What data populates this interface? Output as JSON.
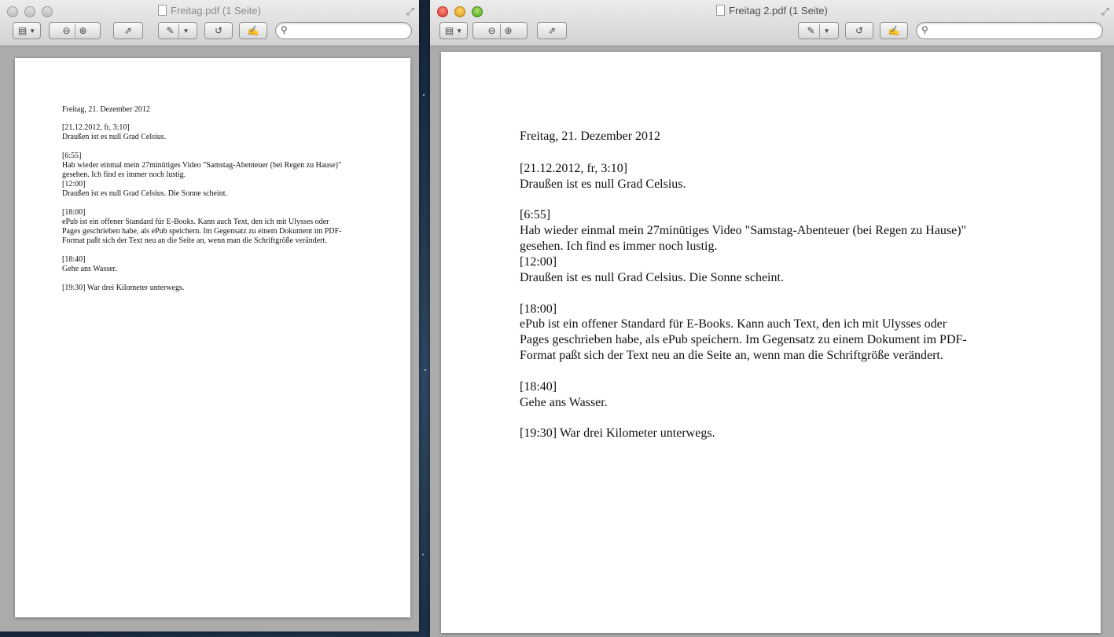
{
  "windows": [
    {
      "title": "Freitag.pdf (1 Seite)",
      "active": false,
      "toolbar": {
        "sidebar_icon": "sidebar-toggle-icon",
        "zoom_out_icon": "zoom-out-icon",
        "zoom_in_icon": "zoom-in-icon",
        "share_icon": "share-icon",
        "markup_icon": "highlighter-icon",
        "rotate_icon": "rotate-icon",
        "edit_icon": "annotate-icon",
        "search_placeholder": ""
      }
    },
    {
      "title": "Freitag 2.pdf (1 Seite)",
      "active": true,
      "toolbar": {
        "sidebar_icon": "sidebar-toggle-icon",
        "zoom_out_icon": "zoom-out-icon",
        "zoom_in_icon": "zoom-in-icon",
        "share_icon": "share-icon",
        "markup_icon": "highlighter-icon",
        "rotate_icon": "rotate-icon",
        "edit_icon": "annotate-icon",
        "search_placeholder": ""
      }
    }
  ],
  "document": {
    "heading": "Freitag, 21. Dezember 2012",
    "entries": [
      {
        "lines": [
          "[21.12.2012, fr, 3:10]",
          "Draußen ist es null Grad Celsius."
        ]
      },
      {
        "lines": [
          "[6:55]",
          "Hab wieder einmal mein 27minütiges Video \"Samstag-Abenteuer (bei Regen zu Hause)\"",
          "gesehen.  Ich find es immer noch lustig.",
          "[12:00]",
          "Draußen ist es null Grad Celsius. Die Sonne scheint."
        ]
      },
      {
        "lines": [
          "[18:00]",
          "ePub ist ein offener Standard für E-Books.  Kann auch Text, den ich mit Ulysses oder",
          "Pages geschrieben habe, als ePub speichern.  Im Gegensatz zu einem Dokument im PDF-",
          "Format paßt sich der Text neu an die Seite an, wenn man die Schriftgröße verändert."
        ]
      },
      {
        "lines": [
          "[18:40]",
          "Gehe ans Wasser."
        ]
      },
      {
        "lines": [
          "[19:30]  War drei Kilometer unterwegs."
        ]
      }
    ]
  }
}
